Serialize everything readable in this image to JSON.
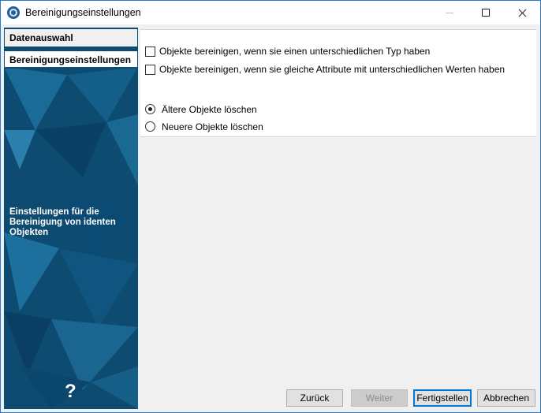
{
  "window": {
    "title": "Bereinigungseinstellungen"
  },
  "sidebar": {
    "steps": [
      {
        "label": "Datenauswahl"
      },
      {
        "label": "Bereinigungseinstellungen"
      }
    ],
    "description": "Einstellungen für die Bereinigung von identen Objekten",
    "help": "?"
  },
  "options": {
    "checkboxes": [
      {
        "label": "Objekte bereinigen, wenn sie einen unterschiedlichen Typ haben",
        "checked": false
      },
      {
        "label": "Objekte bereinigen, wenn sie gleiche Attribute mit unterschiedlichen Werten haben",
        "checked": false
      }
    ],
    "radios": [
      {
        "label": "Ältere Objekte löschen",
        "selected": true
      },
      {
        "label": "Neuere Objekte löschen",
        "selected": false
      }
    ]
  },
  "buttons": {
    "back": "Zurück",
    "next": "Weiter",
    "finish": "Fertigstellen",
    "cancel": "Abbrechen"
  }
}
